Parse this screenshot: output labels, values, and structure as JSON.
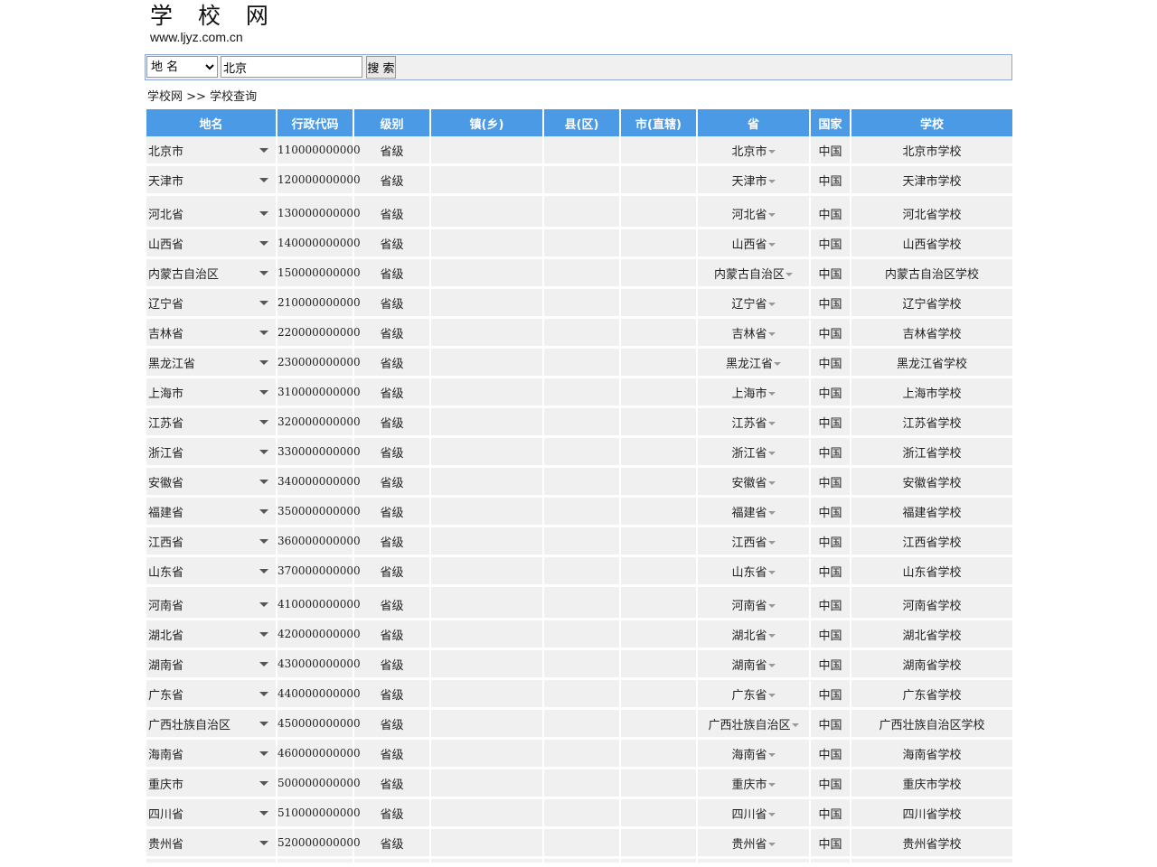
{
  "site": {
    "title": "学 校 网",
    "url": "www.ljyz.com.cn"
  },
  "search": {
    "select_value": "地 名",
    "input_value": "北京",
    "button_label": "搜 索"
  },
  "breadcrumb": {
    "home": "学校网",
    "sep": ">>",
    "current": "学校查询"
  },
  "table": {
    "headers": [
      "地名",
      "行政代码",
      "级别",
      "镇(乡)",
      "县(区)",
      "市(直辖)",
      "省",
      "国家",
      "学校"
    ],
    "rows": [
      {
        "name": "北京市",
        "code": "110000000000",
        "level": "省级",
        "province": "北京市",
        "country": "中国",
        "school": "北京市学校"
      },
      {
        "name": "天津市",
        "code": "120000000000",
        "level": "省级",
        "province": "天津市",
        "country": "中国",
        "school": "天津市学校"
      },
      {
        "name": "河北省",
        "code": "130000000000",
        "level": "省级",
        "province": "河北省",
        "country": "中国",
        "school": "河北省学校"
      },
      {
        "name": "山西省",
        "code": "140000000000",
        "level": "省级",
        "province": "山西省",
        "country": "中国",
        "school": "山西省学校"
      },
      {
        "name": "内蒙古自治区",
        "code": "150000000000",
        "level": "省级",
        "province": "内蒙古自治区",
        "country": "中国",
        "school": "内蒙古自治区学校"
      },
      {
        "name": "辽宁省",
        "code": "210000000000",
        "level": "省级",
        "province": "辽宁省",
        "country": "中国",
        "school": "辽宁省学校"
      },
      {
        "name": "吉林省",
        "code": "220000000000",
        "level": "省级",
        "province": "吉林省",
        "country": "中国",
        "school": "吉林省学校"
      },
      {
        "name": "黑龙江省",
        "code": "230000000000",
        "level": "省级",
        "province": "黑龙江省",
        "country": "中国",
        "school": "黑龙江省学校"
      },
      {
        "name": "上海市",
        "code": "310000000000",
        "level": "省级",
        "province": "上海市",
        "country": "中国",
        "school": "上海市学校"
      },
      {
        "name": "江苏省",
        "code": "320000000000",
        "level": "省级",
        "province": "江苏省",
        "country": "中国",
        "school": "江苏省学校"
      },
      {
        "name": "浙江省",
        "code": "330000000000",
        "level": "省级",
        "province": "浙江省",
        "country": "中国",
        "school": "浙江省学校"
      },
      {
        "name": "安徽省",
        "code": "340000000000",
        "level": "省级",
        "province": "安徽省",
        "country": "中国",
        "school": "安徽省学校"
      },
      {
        "name": "福建省",
        "code": "350000000000",
        "level": "省级",
        "province": "福建省",
        "country": "中国",
        "school": "福建省学校"
      },
      {
        "name": "江西省",
        "code": "360000000000",
        "level": "省级",
        "province": "江西省",
        "country": "中国",
        "school": "江西省学校"
      },
      {
        "name": "山东省",
        "code": "370000000000",
        "level": "省级",
        "province": "山东省",
        "country": "中国",
        "school": "山东省学校"
      },
      {
        "name": "河南省",
        "code": "410000000000",
        "level": "省级",
        "province": "河南省",
        "country": "中国",
        "school": "河南省学校"
      },
      {
        "name": "湖北省",
        "code": "420000000000",
        "level": "省级",
        "province": "湖北省",
        "country": "中国",
        "school": "湖北省学校"
      },
      {
        "name": "湖南省",
        "code": "430000000000",
        "level": "省级",
        "province": "湖南省",
        "country": "中国",
        "school": "湖南省学校"
      },
      {
        "name": "广东省",
        "code": "440000000000",
        "level": "省级",
        "province": "广东省",
        "country": "中国",
        "school": "广东省学校"
      },
      {
        "name": "广西壮族自治区",
        "code": "450000000000",
        "level": "省级",
        "province": "广西壮族自治区",
        "country": "中国",
        "school": "广西壮族自治区学校"
      },
      {
        "name": "海南省",
        "code": "460000000000",
        "level": "省级",
        "province": "海南省",
        "country": "中国",
        "school": "海南省学校"
      },
      {
        "name": "重庆市",
        "code": "500000000000",
        "level": "省级",
        "province": "重庆市",
        "country": "中国",
        "school": "重庆市学校"
      },
      {
        "name": "四川省",
        "code": "510000000000",
        "level": "省级",
        "province": "四川省",
        "country": "中国",
        "school": "四川省学校"
      },
      {
        "name": "贵州省",
        "code": "520000000000",
        "level": "省级",
        "province": "贵州省",
        "country": "中国",
        "school": "贵州省学校"
      }
    ]
  }
}
